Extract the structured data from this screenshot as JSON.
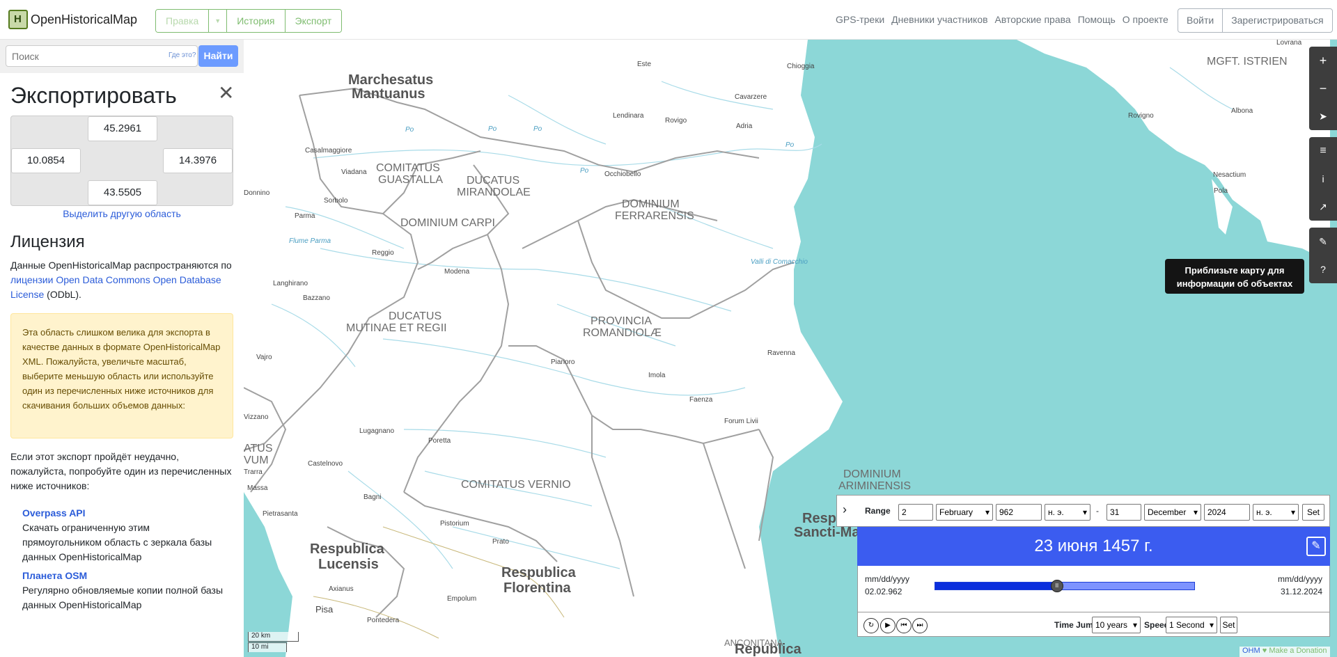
{
  "header": {
    "brand": "OpenHistoricalMap",
    "logo_letter": "H",
    "edit_label": "Правка",
    "history_label": "История",
    "export_label": "Экспорт",
    "nav": [
      "GPS-треки",
      "Дневники участников",
      "Авторские права",
      "Помощь",
      "О проекте"
    ],
    "login_label": "Войти",
    "signup_label": "Зарегистрироваться"
  },
  "search": {
    "placeholder": "Поиск",
    "where_label": "Где это?",
    "go_label": "Найти"
  },
  "export": {
    "title": "Экспортировать",
    "north": "45.2961",
    "west": "10.0854",
    "east": "14.3976",
    "south": "43.5505",
    "select_other": "Выделить другую область",
    "license_heading": "Лицензия",
    "license_pre": "Данные OpenHistoricalMap распространяются по",
    "license_link": "лицензии Open Data Commons Open Database License",
    "license_post": "(ODbL).",
    "warning": "Эта область слишком велика для экспорта в качестве данных в формате OpenHistoricalMap XML. Пожалуйста, увеличьте масштаб, выберите меньшую область или используйте один из перечисленных ниже источников для скачивания больших объемов данных:",
    "fail_text": "Если этот экспорт пройдёт неудачно, пожалуйста, попробуйте один из перечисленных ниже источников:",
    "sources": [
      {
        "title": "Overpass API",
        "desc": "Скачать ограниченную этим прямоугольником область с зеркала базы данных OpenHistoricalMap"
      },
      {
        "title": "Планета OSM",
        "desc": "Регулярно обновляемые копии полной базы данных OpenHistoricalMap"
      }
    ]
  },
  "map": {
    "labels_big": [
      "Marchesatus",
      "Mantuanus",
      "Respublica",
      "Lucensis",
      "Respublica",
      "Florentina",
      "Republica",
      "Resp",
      "Sancti-Ma"
    ],
    "labels_mid": [
      "COMITATUS",
      "GUASTALLA",
      "DUCATUS",
      "MIRANDOLAE",
      "DOMINIUM",
      "FERRARENSIS",
      "DOMINIUM CARPI",
      "DUCATUS",
      "MUTINAE ET REGII",
      "PROVINCIA",
      "ROMANDIOLÆ",
      "COMITATUS VERNIO",
      "DOMINIUM",
      "ARIMINENSIS",
      "MGFT. ISTRIEN",
      "ATUS",
      "VUM",
      "ANCONITANA"
    ],
    "cities": [
      "Este",
      "Chioggia",
      "Cavarzere",
      "Lendinara",
      "Rovigo",
      "Adria",
      "Casalmaggiore",
      "Viadana",
      "Occhiobello",
      "Sorbolo",
      "Donnino",
      "Parma",
      "Reggio",
      "Modena",
      "Langhirano",
      "Bazzano",
      "Vajro",
      "Pianoro",
      "Imola",
      "Faenza",
      "Ravenna",
      "Forum Livii",
      "Lugagnano",
      "Poretta",
      "Castelnovo",
      "Bagni",
      "Massa",
      "Pietrasanta",
      "Pistorium",
      "Prato",
      "Axianus",
      "Empolum",
      "Pisa",
      "Pontedera",
      "Rovigno",
      "Albona",
      "Pola",
      "Nesactium",
      "Lovrana",
      "Trarra",
      "Vizzano"
    ],
    "water": [
      "Po",
      "Po",
      "Po",
      "Po",
      "Po",
      "Flume Parma",
      "Valli di Comacchio"
    ],
    "scale_km": "20 km",
    "scale_mi": "10 mi",
    "attribution_ohm": "OHM",
    "attribution_heart": "♥",
    "attribution_donate": "Make a Donation",
    "tooltip": "Приблизьте карту для информации об объектах"
  },
  "timeslider": {
    "range_label": "Range",
    "start_day": "2",
    "start_month": "February",
    "start_year": "962",
    "start_era": "н. э.",
    "dash": "-",
    "end_day": "31",
    "end_month": "December",
    "end_year": "2024",
    "end_era": "н. э.",
    "set_label": "Set",
    "current_date": "23 июня 1457 г.",
    "min_format": "mm/dd/yyyy",
    "min_date": "02.02.962",
    "max_format": "mm/dd/yyyy",
    "max_date": "31.12.2024",
    "position_fraction": 0.47,
    "time_jump_label": "Time Jump",
    "time_jump_value": "10 years",
    "speed_label": "Speed",
    "speed_value": "1 Second",
    "set2_label": "Set"
  },
  "colors": {
    "sea": "#8cd7d7",
    "border": "#a0a0a0",
    "river": "#a8dbe8",
    "accent_green": "#7ebc6f",
    "date_bar": "#3b5cf0"
  }
}
